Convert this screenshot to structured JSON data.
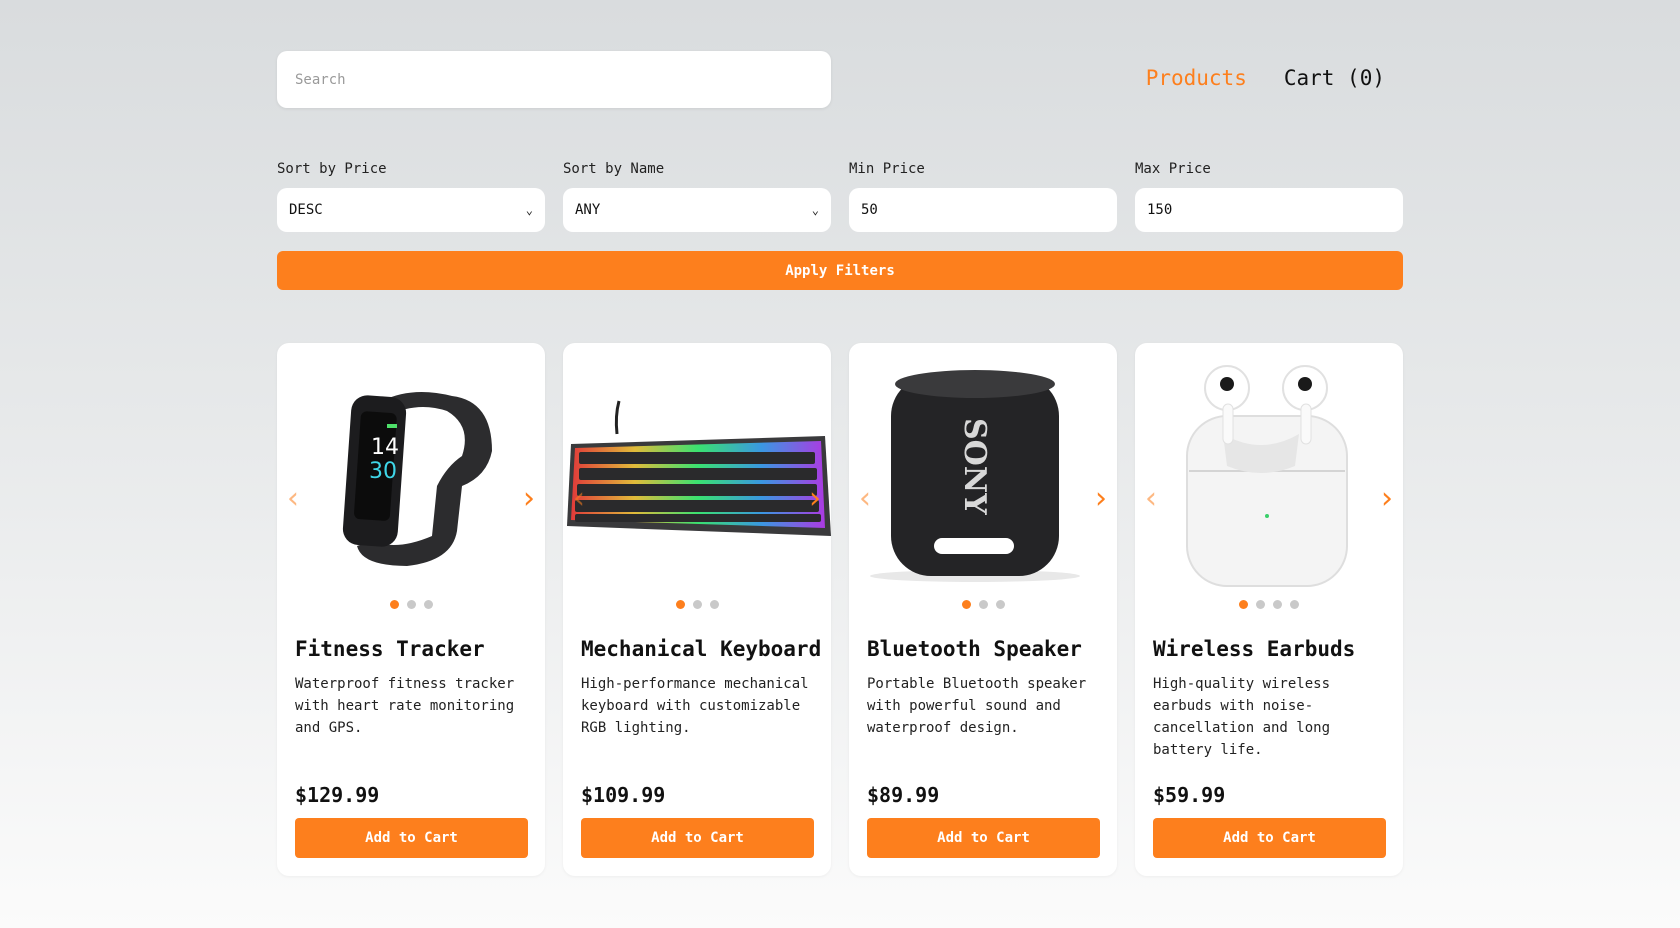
{
  "search": {
    "placeholder": "Search"
  },
  "nav": {
    "products": "Products",
    "cart": "Cart (0)"
  },
  "filters": {
    "sort_price": {
      "label": "Sort by Price",
      "value": "DESC"
    },
    "sort_name": {
      "label": "Sort by Name",
      "value": "ANY"
    },
    "min_price": {
      "label": "Min Price",
      "value": "50"
    },
    "max_price": {
      "label": "Max Price",
      "value": "150"
    },
    "apply_label": "Apply Filters"
  },
  "colors": {
    "accent": "#fd7f1d"
  },
  "products": [
    {
      "title": "Fitness Tracker",
      "desc": "Waterproof fitness tracker with heart rate monitoring and GPS.",
      "price": "$129.99",
      "button": "Add to Cart",
      "images": 3,
      "image_text": [
        "14",
        "30"
      ]
    },
    {
      "title": "Mechanical Keyboard",
      "desc": "High-performance mechanical keyboard with customizable RGB lighting.",
      "price": "$109.99",
      "button": "Add to Cart",
      "images": 3
    },
    {
      "title": "Bluetooth Speaker",
      "desc": "Portable Bluetooth speaker with powerful sound and waterproof design.",
      "price": "$89.99",
      "button": "Add to Cart",
      "images": 3,
      "image_text": [
        "SONY"
      ]
    },
    {
      "title": "Wireless Earbuds",
      "desc": "High-quality wireless earbuds with noise-cancellation and long battery life.",
      "price": "$59.99",
      "button": "Add to Cart",
      "images": 4
    }
  ]
}
